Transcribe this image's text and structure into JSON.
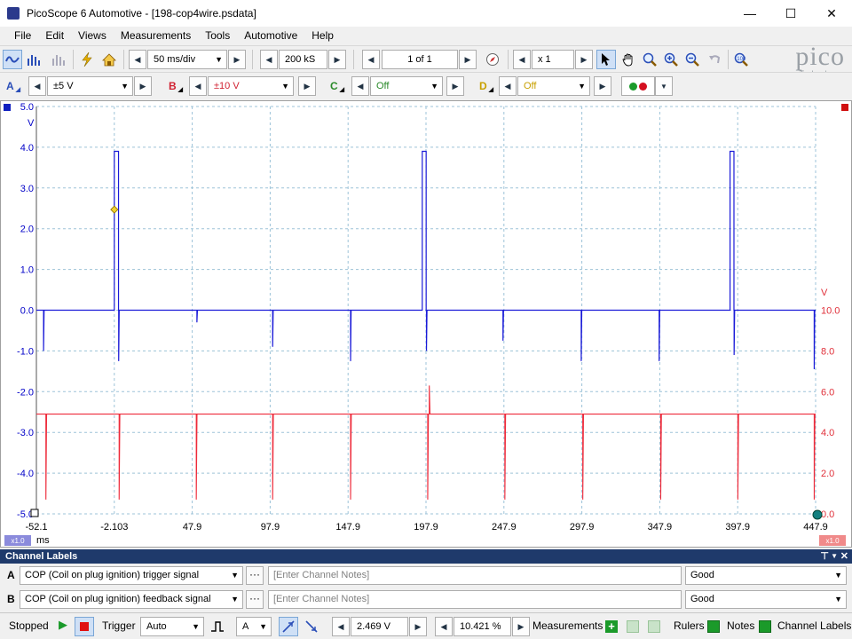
{
  "window": {
    "title": "PicoScope 6 Automotive - [198-cop4wire.psdata]"
  },
  "menu": [
    "File",
    "Edit",
    "Views",
    "Measurements",
    "Tools",
    "Automotive",
    "Help"
  ],
  "toolbar": {
    "timebase": "50 ms/div",
    "samples": "200 kS",
    "buffer": "1 of 1",
    "zoom": "x 1",
    "logo": "pico",
    "logo_sub": "Technology"
  },
  "channels": {
    "a": {
      "letter": "A",
      "range": "±5 V",
      "color": "#0000c8"
    },
    "b": {
      "letter": "B",
      "range": "±10 V",
      "color": "#e0303a"
    },
    "c": {
      "letter": "C",
      "range": "Off",
      "color": "#2a8a2a"
    },
    "d": {
      "letter": "D",
      "range": "Off",
      "color": "#c8a000"
    }
  },
  "scope": {
    "left_axis": [
      "5.0",
      "4.0",
      "3.0",
      "2.0",
      "1.0",
      "0.0",
      "-1.0",
      "-2.0",
      "-3.0",
      "-4.0",
      "-5.0"
    ],
    "left_unit": "V",
    "right_axis": [
      "10.0",
      "8.0",
      "6.0",
      "4.0",
      "2.0",
      "0.0"
    ],
    "right_unit": "V",
    "x_axis": [
      "-52.1",
      "-2.103",
      "47.9",
      "97.9",
      "147.9",
      "197.9",
      "247.9",
      "297.9",
      "347.9",
      "397.9",
      "447.9"
    ],
    "x_unit": "ms",
    "zoom_left": "x1.0",
    "zoom_right": "x1.0"
  },
  "channel_labels": {
    "header": "Channel Labels",
    "rows": [
      {
        "letter": "A",
        "signal": "COP (Coil on plug ignition) trigger signal",
        "notes_placeholder": "[Enter Channel Notes]",
        "quality": "Good"
      },
      {
        "letter": "B",
        "signal": "COP (Coil on plug ignition) feedback signal",
        "notes_placeholder": "[Enter Channel Notes]",
        "quality": "Good"
      }
    ]
  },
  "status": {
    "state": "Stopped",
    "trigger_label": "Trigger",
    "trigger_mode": "Auto",
    "trigger_channel": "A",
    "trigger_level": "2.469 V",
    "pretrigger": "10.421 %",
    "measurements": "Measurements",
    "rulers": "Rulers",
    "notes": "Notes",
    "channel_labels": "Channel Labels"
  },
  "chart_data": {
    "type": "line",
    "x_unit": "ms",
    "xlim": [
      -52.1,
      447.9
    ],
    "series": [
      {
        "name": "A",
        "ylim": [
          -5,
          5
        ],
        "baseline": 0.0,
        "pulses": [
          {
            "start": -2.1,
            "end": 0.6,
            "value": 3.9
          },
          {
            "start": 195.5,
            "end": 198.0,
            "value": 3.9
          },
          {
            "start": 393.0,
            "end": 395.5,
            "value": 3.9
          }
        ],
        "spikes": [
          {
            "x": -47.5,
            "value": -1.0
          },
          {
            "x": 0.7,
            "value": -1.25
          },
          {
            "x": 50.9,
            "value": -0.3
          },
          {
            "x": 99.5,
            "value": -0.9
          },
          {
            "x": 149.5,
            "value": -1.25
          },
          {
            "x": 198.2,
            "value": -1.0
          },
          {
            "x": 247.3,
            "value": -0.75
          },
          {
            "x": 297.5,
            "value": -1.25
          },
          {
            "x": 347.5,
            "value": -1.25
          },
          {
            "x": 395.6,
            "value": -1.1
          },
          {
            "x": 447.0,
            "value": -1.45
          }
        ]
      },
      {
        "name": "B",
        "ylim": [
          0,
          10
        ],
        "baseline": 4.9,
        "dips": [
          {
            "x": -46.0,
            "value": 0.7
          },
          {
            "x": 1.0,
            "value": 0.7
          },
          {
            "x": 50.5,
            "value": 0.7
          },
          {
            "x": 99.5,
            "value": 0.7
          },
          {
            "x": 149.5,
            "value": 0.7
          },
          {
            "x": 199.0,
            "value": 0.7
          },
          {
            "x": 248.5,
            "value": 0.7
          },
          {
            "x": 298.5,
            "value": 0.7
          },
          {
            "x": 348.5,
            "value": 0.7
          },
          {
            "x": 398.0,
            "value": 0.7
          },
          {
            "x": 447.0,
            "value": 0.7
          }
        ],
        "peaks": [
          {
            "x": 200.0,
            "value": 6.3
          }
        ]
      }
    ]
  }
}
